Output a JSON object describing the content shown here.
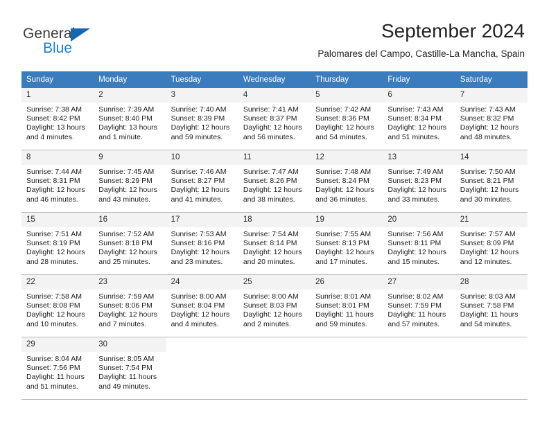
{
  "brand": {
    "name_part1": "General",
    "name_part2": "Blue",
    "triangle_color": "#1767b0",
    "blue_color": "#1b7fd4"
  },
  "header": {
    "title": "September 2024",
    "subtitle": "Palomares del Campo, Castille-La Mancha, Spain",
    "header_bg": "#3a7cbd",
    "daynum_bg": "#f3f3f3"
  },
  "calendar": {
    "weekdays": [
      "Sunday",
      "Monday",
      "Tuesday",
      "Wednesday",
      "Thursday",
      "Friday",
      "Saturday"
    ],
    "weeks": [
      [
        {
          "day": "1",
          "sunrise": "Sunrise: 7:38 AM",
          "sunset": "Sunset: 8:42 PM",
          "daylight_l1": "Daylight: 13 hours",
          "daylight_l2": "and 4 minutes."
        },
        {
          "day": "2",
          "sunrise": "Sunrise: 7:39 AM",
          "sunset": "Sunset: 8:40 PM",
          "daylight_l1": "Daylight: 13 hours",
          "daylight_l2": "and 1 minute."
        },
        {
          "day": "3",
          "sunrise": "Sunrise: 7:40 AM",
          "sunset": "Sunset: 8:39 PM",
          "daylight_l1": "Daylight: 12 hours",
          "daylight_l2": "and 59 minutes."
        },
        {
          "day": "4",
          "sunrise": "Sunrise: 7:41 AM",
          "sunset": "Sunset: 8:37 PM",
          "daylight_l1": "Daylight: 12 hours",
          "daylight_l2": "and 56 minutes."
        },
        {
          "day": "5",
          "sunrise": "Sunrise: 7:42 AM",
          "sunset": "Sunset: 8:36 PM",
          "daylight_l1": "Daylight: 12 hours",
          "daylight_l2": "and 54 minutes."
        },
        {
          "day": "6",
          "sunrise": "Sunrise: 7:43 AM",
          "sunset": "Sunset: 8:34 PM",
          "daylight_l1": "Daylight: 12 hours",
          "daylight_l2": "and 51 minutes."
        },
        {
          "day": "7",
          "sunrise": "Sunrise: 7:43 AM",
          "sunset": "Sunset: 8:32 PM",
          "daylight_l1": "Daylight: 12 hours",
          "daylight_l2": "and 48 minutes."
        }
      ],
      [
        {
          "day": "8",
          "sunrise": "Sunrise: 7:44 AM",
          "sunset": "Sunset: 8:31 PM",
          "daylight_l1": "Daylight: 12 hours",
          "daylight_l2": "and 46 minutes."
        },
        {
          "day": "9",
          "sunrise": "Sunrise: 7:45 AM",
          "sunset": "Sunset: 8:29 PM",
          "daylight_l1": "Daylight: 12 hours",
          "daylight_l2": "and 43 minutes."
        },
        {
          "day": "10",
          "sunrise": "Sunrise: 7:46 AM",
          "sunset": "Sunset: 8:27 PM",
          "daylight_l1": "Daylight: 12 hours",
          "daylight_l2": "and 41 minutes."
        },
        {
          "day": "11",
          "sunrise": "Sunrise: 7:47 AM",
          "sunset": "Sunset: 8:26 PM",
          "daylight_l1": "Daylight: 12 hours",
          "daylight_l2": "and 38 minutes."
        },
        {
          "day": "12",
          "sunrise": "Sunrise: 7:48 AM",
          "sunset": "Sunset: 8:24 PM",
          "daylight_l1": "Daylight: 12 hours",
          "daylight_l2": "and 36 minutes."
        },
        {
          "day": "13",
          "sunrise": "Sunrise: 7:49 AM",
          "sunset": "Sunset: 8:23 PM",
          "daylight_l1": "Daylight: 12 hours",
          "daylight_l2": "and 33 minutes."
        },
        {
          "day": "14",
          "sunrise": "Sunrise: 7:50 AM",
          "sunset": "Sunset: 8:21 PM",
          "daylight_l1": "Daylight: 12 hours",
          "daylight_l2": "and 30 minutes."
        }
      ],
      [
        {
          "day": "15",
          "sunrise": "Sunrise: 7:51 AM",
          "sunset": "Sunset: 8:19 PM",
          "daylight_l1": "Daylight: 12 hours",
          "daylight_l2": "and 28 minutes."
        },
        {
          "day": "16",
          "sunrise": "Sunrise: 7:52 AM",
          "sunset": "Sunset: 8:18 PM",
          "daylight_l1": "Daylight: 12 hours",
          "daylight_l2": "and 25 minutes."
        },
        {
          "day": "17",
          "sunrise": "Sunrise: 7:53 AM",
          "sunset": "Sunset: 8:16 PM",
          "daylight_l1": "Daylight: 12 hours",
          "daylight_l2": "and 23 minutes."
        },
        {
          "day": "18",
          "sunrise": "Sunrise: 7:54 AM",
          "sunset": "Sunset: 8:14 PM",
          "daylight_l1": "Daylight: 12 hours",
          "daylight_l2": "and 20 minutes."
        },
        {
          "day": "19",
          "sunrise": "Sunrise: 7:55 AM",
          "sunset": "Sunset: 8:13 PM",
          "daylight_l1": "Daylight: 12 hours",
          "daylight_l2": "and 17 minutes."
        },
        {
          "day": "20",
          "sunrise": "Sunrise: 7:56 AM",
          "sunset": "Sunset: 8:11 PM",
          "daylight_l1": "Daylight: 12 hours",
          "daylight_l2": "and 15 minutes."
        },
        {
          "day": "21",
          "sunrise": "Sunrise: 7:57 AM",
          "sunset": "Sunset: 8:09 PM",
          "daylight_l1": "Daylight: 12 hours",
          "daylight_l2": "and 12 minutes."
        }
      ],
      [
        {
          "day": "22",
          "sunrise": "Sunrise: 7:58 AM",
          "sunset": "Sunset: 8:08 PM",
          "daylight_l1": "Daylight: 12 hours",
          "daylight_l2": "and 10 minutes."
        },
        {
          "day": "23",
          "sunrise": "Sunrise: 7:59 AM",
          "sunset": "Sunset: 8:06 PM",
          "daylight_l1": "Daylight: 12 hours",
          "daylight_l2": "and 7 minutes."
        },
        {
          "day": "24",
          "sunrise": "Sunrise: 8:00 AM",
          "sunset": "Sunset: 8:04 PM",
          "daylight_l1": "Daylight: 12 hours",
          "daylight_l2": "and 4 minutes."
        },
        {
          "day": "25",
          "sunrise": "Sunrise: 8:00 AM",
          "sunset": "Sunset: 8:03 PM",
          "daylight_l1": "Daylight: 12 hours",
          "daylight_l2": "and 2 minutes."
        },
        {
          "day": "26",
          "sunrise": "Sunrise: 8:01 AM",
          "sunset": "Sunset: 8:01 PM",
          "daylight_l1": "Daylight: 11 hours",
          "daylight_l2": "and 59 minutes."
        },
        {
          "day": "27",
          "sunrise": "Sunrise: 8:02 AM",
          "sunset": "Sunset: 7:59 PM",
          "daylight_l1": "Daylight: 11 hours",
          "daylight_l2": "and 57 minutes."
        },
        {
          "day": "28",
          "sunrise": "Sunrise: 8:03 AM",
          "sunset": "Sunset: 7:58 PM",
          "daylight_l1": "Daylight: 11 hours",
          "daylight_l2": "and 54 minutes."
        }
      ],
      [
        {
          "day": "29",
          "sunrise": "Sunrise: 8:04 AM",
          "sunset": "Sunset: 7:56 PM",
          "daylight_l1": "Daylight: 11 hours",
          "daylight_l2": "and 51 minutes."
        },
        {
          "day": "30",
          "sunrise": "Sunrise: 8:05 AM",
          "sunset": "Sunset: 7:54 PM",
          "daylight_l1": "Daylight: 11 hours",
          "daylight_l2": "and 49 minutes."
        },
        null,
        null,
        null,
        null,
        null
      ]
    ]
  }
}
